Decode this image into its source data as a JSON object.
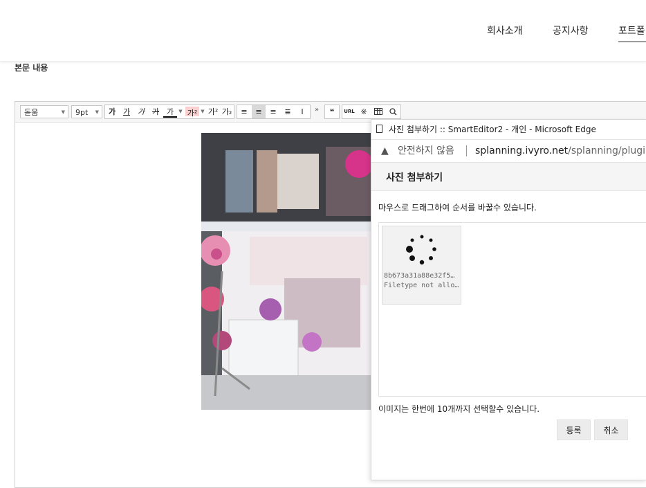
{
  "nav": {
    "items": [
      "회사소개",
      "공지사항",
      "포트폴"
    ]
  },
  "section_label": "본문 내용",
  "toolbar": {
    "font_family": "돋움",
    "font_size": "9pt",
    "buttons": [
      "가",
      "가",
      "가",
      "가",
      "가",
      "가²",
      "가₂"
    ],
    "more": "»",
    "quote": "❝",
    "url": "URL",
    "special": "※",
    "table": "table-icon",
    "search": "search-icon"
  },
  "popup": {
    "window_title": "사진 첨부하기 :: SmartEditor2 - 개인 - Microsoft Edge",
    "security_label": "안전하지 않음",
    "url_host": "splanning.ivyro.net",
    "url_path": "/splanning/plugin/ed",
    "dialog_title": "사진 첨부하기",
    "drag_hint": "마우스로 드래그하여 순서를 바꿀수 있습니다.",
    "file": {
      "name": "8b673a31a88e32f5…",
      "status": "Filetype not allo…"
    },
    "limit_text": "이미지는 한번에 10개까지 선택할수 있습니다.",
    "ok_label": "등록",
    "cancel_label": "취소"
  }
}
